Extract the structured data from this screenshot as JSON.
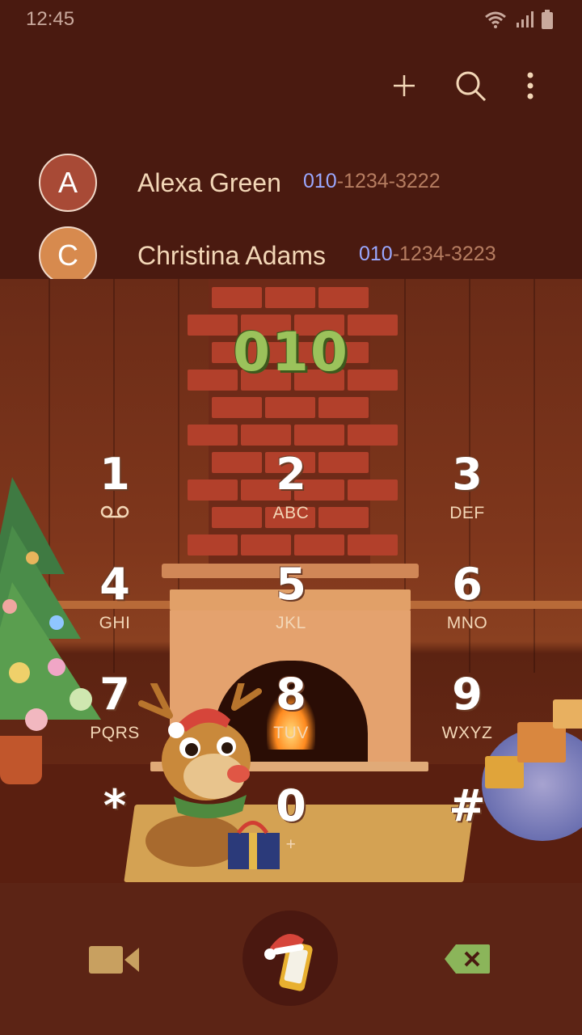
{
  "status_bar": {
    "time": "12:45",
    "icons": [
      "wifi-icon",
      "signal-icon",
      "battery-icon"
    ]
  },
  "toolbar": {
    "actions": [
      "add-icon",
      "search-icon",
      "more-options-icon"
    ]
  },
  "suggestions": [
    {
      "initial": "A",
      "name": "Alexa Green",
      "number_prefix": "010",
      "number_rest": "-1234-3222",
      "avatar_color": "#a84a36"
    },
    {
      "initial": "C",
      "name": "Christina Adams",
      "number_prefix": "010",
      "number_rest": "-1234-3223",
      "avatar_color": "#d78a4e"
    }
  ],
  "dialer": {
    "entered_number": "010",
    "keys": [
      {
        "digit": "1",
        "letters": ""
      },
      {
        "digit": "2",
        "letters": "ABC"
      },
      {
        "digit": "3",
        "letters": "DEF"
      },
      {
        "digit": "4",
        "letters": "GHI"
      },
      {
        "digit": "5",
        "letters": "JKL"
      },
      {
        "digit": "6",
        "letters": "MNO"
      },
      {
        "digit": "7",
        "letters": "PQRS"
      },
      {
        "digit": "8",
        "letters": "TUV"
      },
      {
        "digit": "9",
        "letters": "WXYZ"
      },
      {
        "digit": "*",
        "letters": ""
      },
      {
        "digit": "0",
        "letters": "+"
      },
      {
        "digit": "#",
        "letters": ""
      }
    ]
  },
  "bottom_bar": {
    "actions": [
      "video-call-icon",
      "call-icon",
      "backspace-icon"
    ]
  },
  "colors": {
    "background": "#4a1a10",
    "name_text": "#f3d7b7",
    "number_highlight": "#9aa8ff",
    "number_text": "#b67d61",
    "dial_number": "#9bc25b"
  }
}
